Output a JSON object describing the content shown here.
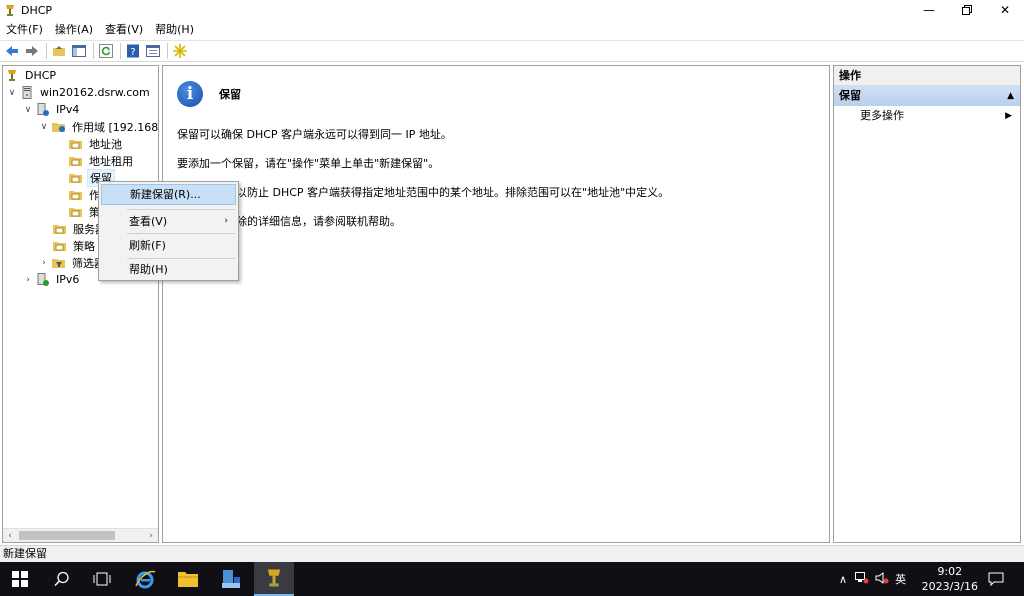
{
  "window": {
    "title": "DHCP"
  },
  "menu": [
    "文件(F)",
    "操作(A)",
    "查看(V)",
    "帮助(H)"
  ],
  "tree": {
    "root": "DHCP",
    "server": "win20162.dsrw.com",
    "ipv4": "IPv4",
    "scope": "作用域 [192.168.1",
    "address_pool": "地址池",
    "address_leases": "地址租用",
    "reservations": "保留",
    "scope_options": "作",
    "policies_sub": "策",
    "server_options": "服务器",
    "policies": "策略",
    "filters": "筛选器",
    "ipv6": "IPv6"
  },
  "content": {
    "title": "保留",
    "p1": "保留可以确保 DHCP 客户端永远可以得到同一 IP 地址。",
    "p2": "要添加一个保留，请在\"操作\"菜单上单击\"新建保留\"。",
    "p3": "以防止 DHCP 客户端获得指定地址范围中的某个地址。排除范围可以在\"地址池\"中定义。",
    "p4": "除的详细信息，请参阅联机帮助。"
  },
  "actions": {
    "header": "操作",
    "section": "保留",
    "more": "更多操作"
  },
  "context_menu": {
    "new_reservation": "新建保留(R)...",
    "view": "查看(V)",
    "refresh": "刷新(F)",
    "help": "帮助(H)"
  },
  "status": "新建保留",
  "taskbar": {
    "ime": "英",
    "time": "9:02",
    "date": "2023/3/16"
  }
}
